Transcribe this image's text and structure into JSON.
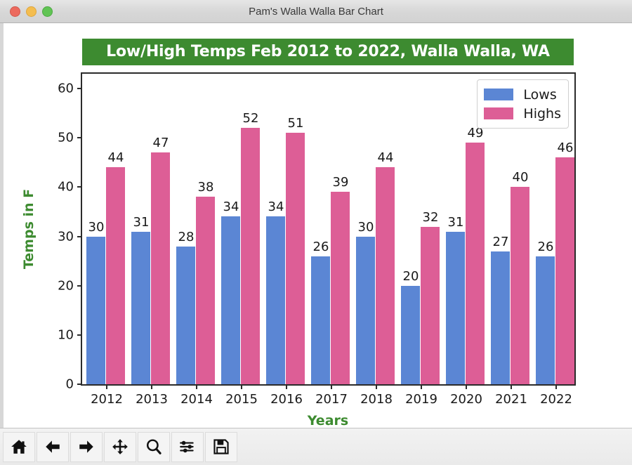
{
  "window": {
    "title": "Pam's Walla Walla Bar Chart",
    "controls": [
      {
        "name": "close-button",
        "color": "#ec6a5e"
      },
      {
        "name": "minimize-button",
        "color": "#f4bd4f"
      },
      {
        "name": "maximize-button",
        "color": "#61c454"
      }
    ]
  },
  "colors": {
    "title_banner_bg": "#3d8b30",
    "title_banner_text": "#ffffff",
    "axis_label_green": "#3d8b30",
    "lows_bar": "#5b86d4",
    "highs_bar": "#dd5e96",
    "frame": "#2b2b2b"
  },
  "toolbar": {
    "buttons": [
      {
        "icon": "home-icon",
        "label": "Home"
      },
      {
        "icon": "back-arrow-icon",
        "label": "Back"
      },
      {
        "icon": "forward-arrow-icon",
        "label": "Forward"
      },
      {
        "icon": "pan-move-icon",
        "label": "Pan"
      },
      {
        "icon": "magnifier-zoom-icon",
        "label": "Zoom"
      },
      {
        "icon": "sliders-configure-icon",
        "label": "Configure subplots"
      },
      {
        "icon": "floppy-save-icon",
        "label": "Save"
      }
    ]
  },
  "chart_data": {
    "type": "bar",
    "title": "Low/High Temps Feb 2012 to 2022, Walla Walla, WA",
    "xlabel": "Years",
    "ylabel": "Temps in F",
    "categories": [
      "2012",
      "2013",
      "2014",
      "2015",
      "2016",
      "2017",
      "2018",
      "2019",
      "2020",
      "2021",
      "2022"
    ],
    "series": [
      {
        "name": "Lows",
        "color": "#5b86d4",
        "values": [
          30,
          31,
          28,
          34,
          34,
          26,
          30,
          20,
          31,
          27,
          26
        ]
      },
      {
        "name": "Highs",
        "color": "#dd5e96",
        "values": [
          44,
          47,
          38,
          52,
          51,
          39,
          44,
          32,
          49,
          40,
          46
        ]
      }
    ],
    "ylim": [
      0,
      63
    ],
    "yticks": [
      0,
      10,
      20,
      30,
      40,
      50,
      60
    ],
    "ytick_labels": [
      "0",
      "10",
      "20",
      "30",
      "40",
      "50",
      "60"
    ],
    "grid": false,
    "legend_position": "upper right",
    "bar_labels": true
  }
}
